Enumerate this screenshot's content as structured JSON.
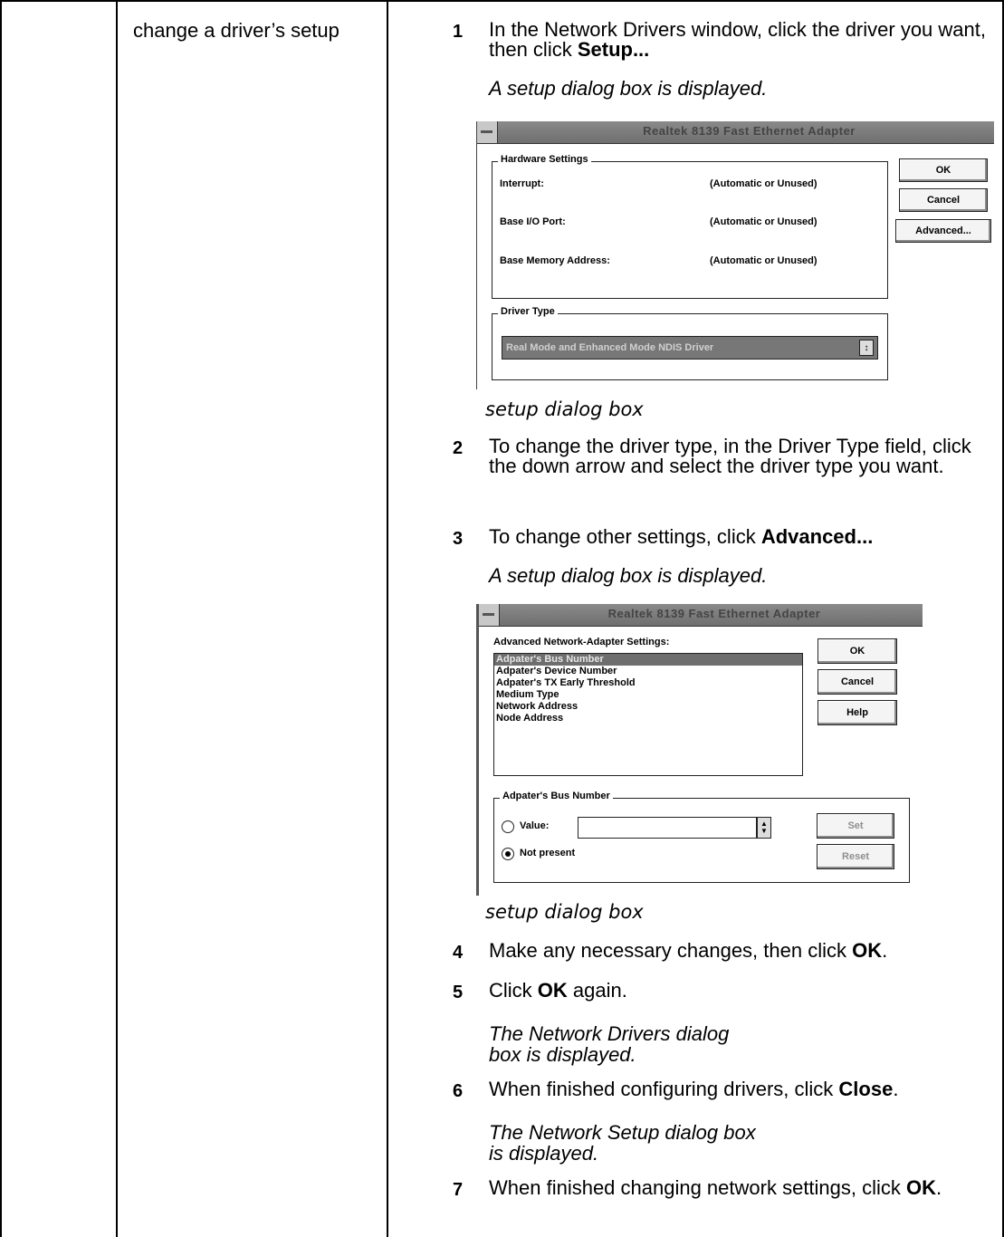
{
  "task": "change a driver’s setup",
  "steps": [
    {
      "num": "1",
      "text_a": "In the Network Drivers window, click the driver you want, then click ",
      "bold": "Setup...",
      "text_b": ""
    },
    {
      "num": "2",
      "text_a": "To change the driver type, in the Driver Type field, click the down arrow and select the driver type you want.",
      "bold": "",
      "text_b": ""
    },
    {
      "num": "3",
      "text_a": "To change other settings, click ",
      "bold": "Advanced...",
      "text_b": ""
    },
    {
      "num": "4",
      "text_a": "Make any necessary changes, then click ",
      "bold": "OK",
      "text_b": "."
    },
    {
      "num": "5",
      "text_a": "Click ",
      "bold": "OK",
      "text_b": " again."
    },
    {
      "num": "6",
      "text_a": "When finished configuring drivers, click ",
      "bold": "Close",
      "text_b": "."
    },
    {
      "num": "7",
      "text_a": "When finished changing network settings, click ",
      "bold": "OK",
      "text_b": "."
    }
  ],
  "notes": {
    "after_step1": "A setup dialog box is displayed.",
    "after_step3": "A setup dialog box is displayed.",
    "after_step5": "The Network Drivers dialog box is displayed.",
    "after_step6": "The Network Setup dialog box is displayed."
  },
  "captions": {
    "fig1": "setup dialog box",
    "fig2": "setup dialog box"
  },
  "dialog1": {
    "title": "Realtek 8139 Fast Ethernet Adapter",
    "hw_group": "Hardware Settings",
    "rows": [
      {
        "label": "Interrupt:",
        "value": "(Automatic or Unused)"
      },
      {
        "label": "Base I/O Port:",
        "value": "(Automatic or Unused)"
      },
      {
        "label": "Base Memory Address:",
        "value": "(Automatic or Unused)"
      }
    ],
    "driver_group": "Driver Type",
    "driver_value": "Real Mode and Enhanced Mode NDIS Driver",
    "buttons": {
      "ok": "OK",
      "cancel": "Cancel",
      "advanced": "Advanced..."
    }
  },
  "dialog2": {
    "title": "Realtek 8139 Fast Ethernet Adapter",
    "list_label": "Advanced Network-Adapter Settings:",
    "list_items": [
      "Adpater's Bus Number",
      "Adpater's Device Number",
      "Adpater's TX Early Threshold",
      "Medium Type",
      "Network Address",
      "Node Address"
    ],
    "group": "Adpater's Bus Number",
    "value_label": "Value:",
    "not_present_label": "Not present",
    "buttons": {
      "ok": "OK",
      "cancel": "Cancel",
      "help": "Help",
      "set": "Set",
      "reset": "Reset"
    }
  }
}
